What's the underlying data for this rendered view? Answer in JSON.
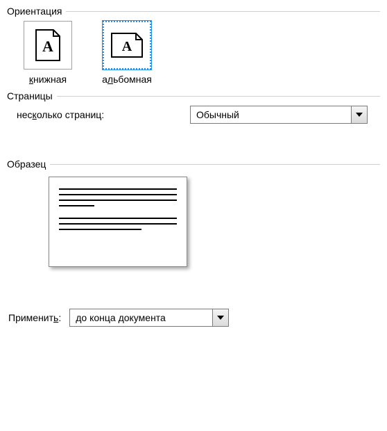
{
  "orientation": {
    "group_label": "Ориентация",
    "portrait_label_pre": "",
    "portrait_key": "к",
    "portrait_label_post": "нижная",
    "landscape_label_pre": "а",
    "landscape_key": "л",
    "landscape_label_post": "ьбомная",
    "selected": "landscape"
  },
  "pages": {
    "group_label": "Страницы",
    "multi_pre": "нес",
    "multi_key": "к",
    "multi_post": "олько страниц:",
    "value": "Обычный"
  },
  "preview": {
    "group_label": "Образец"
  },
  "apply": {
    "label_pre": "Применит",
    "label_key": "ь",
    "label_post": ":",
    "value": "до конца документа"
  }
}
